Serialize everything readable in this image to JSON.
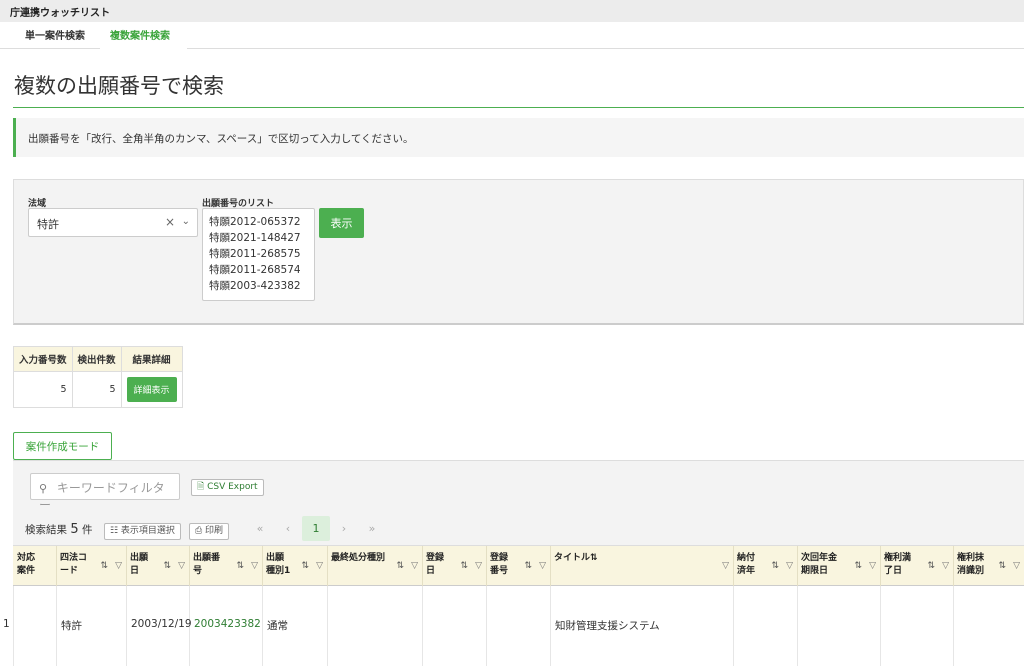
{
  "app_title": "庁連携ウォッチリスト",
  "tabs": [
    {
      "label": "単一案件検索"
    },
    {
      "label": "複数案件検索"
    }
  ],
  "page_title": "複数の出願番号で検索",
  "notice": "出願番号を「改行、全角半角のカンマ、スペース」で区切って入力してください。",
  "form": {
    "hoiki_label": "法域",
    "hoiki_value": "特許",
    "clear_icon": "×",
    "chevron_icon": "⌄",
    "list_label": "出願番号のリスト",
    "list_items": [
      "特願2012-065372",
      "特願2021-148427",
      "特願2011-268575",
      "特願2011-268574",
      "特願2003-423382"
    ],
    "show_button": "表示"
  },
  "summary": {
    "headers": [
      "入力番号数",
      "検出件数",
      "結果詳細"
    ],
    "input_count": "5",
    "found_count": "5",
    "detail_button": "詳細表示"
  },
  "mode_button": "案件作成モード",
  "toolbar": {
    "search_icon": "⚲",
    "keyword_placeholder": "キーワードフィルター",
    "csv_label": "🗎 CSV Export",
    "result_prefix": "検索結果",
    "result_count": "5",
    "result_suffix": "件",
    "columns_button": "☷ 表示項目選択",
    "print_button": "⎙ 印刷",
    "pager": [
      "«",
      "‹",
      "1",
      "›",
      "»"
    ]
  },
  "grid": {
    "headers": [
      {
        "label": "対応案件",
        "sort": "",
        "filter": ""
      },
      {
        "label": "四法コード",
        "sort": "⇅",
        "filter": "▽"
      },
      {
        "label": "出願日",
        "sort": "⇅",
        "filter": "▽"
      },
      {
        "label": "出願番号",
        "sort": "⇅",
        "filter": "▽"
      },
      {
        "label": "出願種別1",
        "sort": "⇅",
        "filter": "▽"
      },
      {
        "label": "最終処分種別",
        "sort": "⇅",
        "filter": "▽"
      },
      {
        "label": "登録日",
        "sort": "⇅",
        "filter": "▽"
      },
      {
        "label": "登録番号",
        "sort": "⇅",
        "filter": "▽"
      },
      {
        "label": "タイトル⇅",
        "sort": "",
        "filter": "▽"
      },
      {
        "label": "納付済年",
        "sort": "⇅",
        "filter": "▽"
      },
      {
        "label": "次回年金期限日",
        "sort": "⇅",
        "filter": "▽"
      },
      {
        "label": "権利満了日",
        "sort": "⇅",
        "filter": "▽"
      },
      {
        "label": "権利抹消識別",
        "sort": "⇅",
        "filter": "▽"
      }
    ],
    "rows": [
      {
        "no": "1",
        "cells": [
          "",
          "特許",
          "2003/12/19",
          "2003423382",
          "通常",
          "",
          "",
          "",
          "知財管理支援システム",
          "",
          "",
          "",
          ""
        ]
      }
    ]
  }
}
